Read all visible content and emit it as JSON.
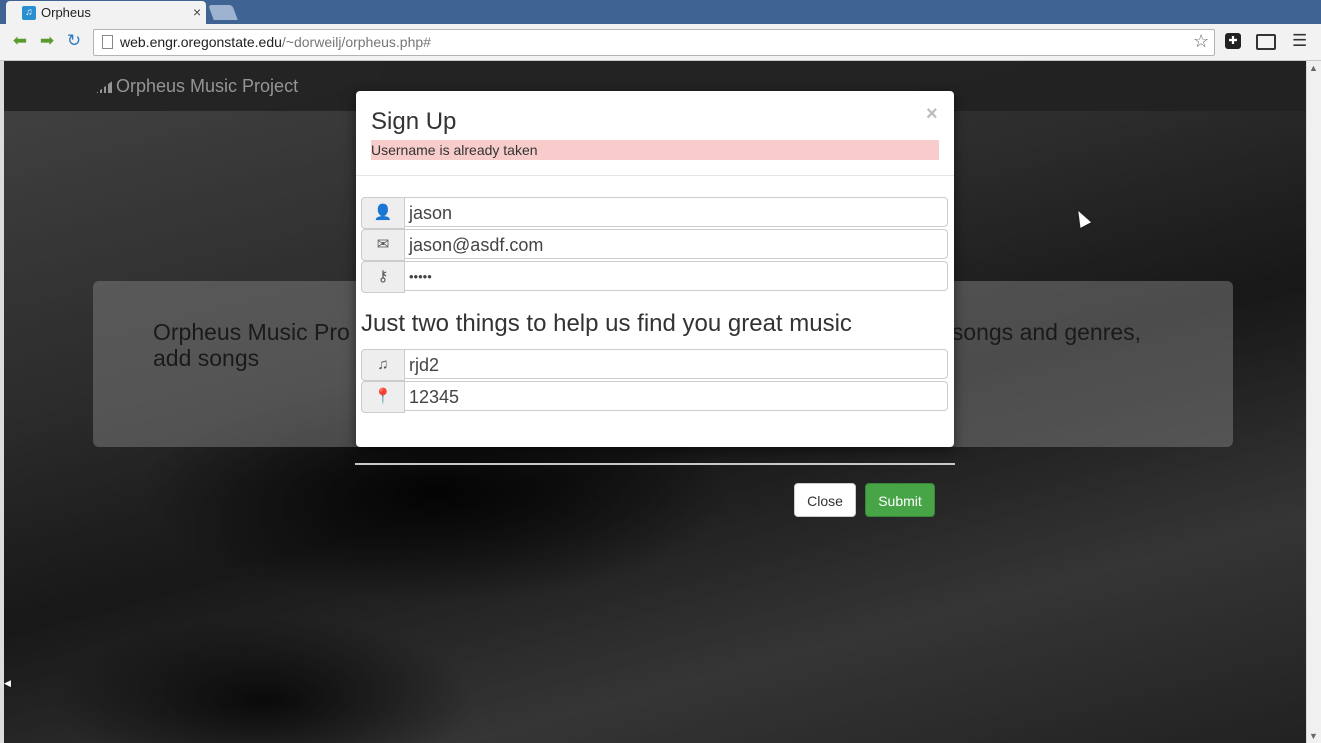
{
  "browser": {
    "tab_title": "Orpheus",
    "tab_close": "×",
    "url_host": "web.engr.oregonstate.edu",
    "url_path": "/~dorweilj/orpheus.php#"
  },
  "page": {
    "brand": "Orpheus Music Project",
    "jumbotron_text": "Orpheus Music Pro                                                                                         for songs and genres, add songs                                                                                                        n."
  },
  "modal": {
    "title": "Sign Up",
    "close_glyph": "×",
    "alert": "Username is already taken",
    "username": "jason",
    "email": "jason@asdf.com",
    "password_mask": "•••••",
    "heading": "Just two things to help us find you great music",
    "artist": "rjd2",
    "zip": "12345",
    "close_label": "Close",
    "submit_label": "Submit"
  }
}
